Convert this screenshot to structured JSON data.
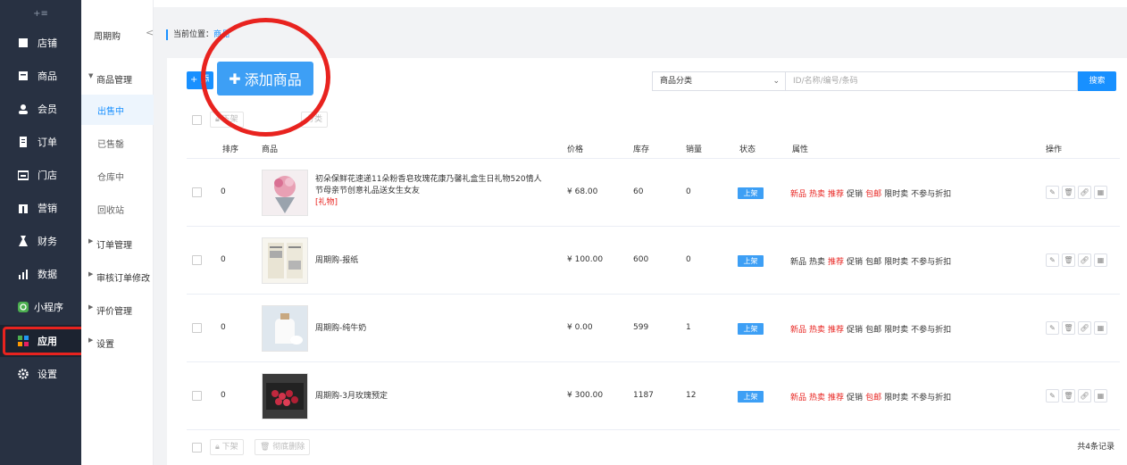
{
  "sidebar": {
    "collapse_icon": "+≡",
    "items": [
      {
        "label": "店铺",
        "icon": "shop-icon"
      },
      {
        "label": "商品",
        "icon": "goods-icon"
      },
      {
        "label": "会员",
        "icon": "member-icon"
      },
      {
        "label": "订单",
        "icon": "order-icon"
      },
      {
        "label": "门店",
        "icon": "store-icon"
      },
      {
        "label": "营销",
        "icon": "gift-icon"
      },
      {
        "label": "财务",
        "icon": "finance-icon"
      },
      {
        "label": "数据",
        "icon": "chart-icon"
      },
      {
        "label": "小程序",
        "icon": "miniprogram-icon"
      },
      {
        "label": "应用",
        "icon": "apps-icon"
      },
      {
        "label": "设置",
        "icon": "gear-icon"
      }
    ]
  },
  "submenu": {
    "title": "周期购",
    "collapse_arrow": "<",
    "groups": [
      {
        "label": "商品管理",
        "expanded": true
      },
      {
        "label": "订单管理"
      },
      {
        "label": "审核订单修改"
      },
      {
        "label": "评价管理"
      },
      {
        "label": "设置"
      }
    ],
    "items": [
      "出售中",
      "已售罄",
      "仓库中",
      "回收站"
    ]
  },
  "breadcrumb": {
    "prefix": "当前位置：",
    "link": "商品"
  },
  "toolbar": {
    "small_add": "+ 添",
    "big_add": "添加商品",
    "category_select": "商品分类",
    "search_placeholder": "ID/名称/编号/条码",
    "search_button": "搜索",
    "top_btn1": "下架",
    "top_btn2": "分类"
  },
  "table": {
    "headers": {
      "sort": "排序",
      "product": "商品",
      "price": "价格",
      "stock": "库存",
      "sales": "销量",
      "status": "状态",
      "attrs": "属性",
      "ops": "操作"
    },
    "rows": [
      {
        "sort": "0",
        "name": "初朵保鲜花速递11朵粉香皂玫瑰花康乃馨礼盒生日礼物520情人节母亲节创意礼品送女生女友",
        "tag": "[礼物]",
        "price": "¥ 68.00",
        "stock": "60",
        "sales": "0",
        "status": "上架",
        "attrs": [
          {
            "t": "新品",
            "c": "#e8231f"
          },
          {
            "t": "热卖",
            "c": "#e8231f"
          },
          {
            "t": "推荐",
            "c": "#e8231f"
          },
          {
            "t": "促销",
            "c": "#333"
          },
          {
            "t": "包邮",
            "c": "#e8231f"
          },
          {
            "t": "限时卖",
            "c": "#333"
          },
          {
            "t": "不参与折扣",
            "c": "#333"
          }
        ]
      },
      {
        "sort": "0",
        "name": "周期购-报纸",
        "tag": "",
        "price": "¥ 100.00",
        "stock": "600",
        "sales": "0",
        "status": "上架",
        "attrs": [
          {
            "t": "新品",
            "c": "#333"
          },
          {
            "t": "热卖",
            "c": "#333"
          },
          {
            "t": "推荐",
            "c": "#e8231f"
          },
          {
            "t": "促销",
            "c": "#333"
          },
          {
            "t": "包邮",
            "c": "#333"
          },
          {
            "t": "限时卖",
            "c": "#333"
          },
          {
            "t": "不参与折扣",
            "c": "#333"
          }
        ]
      },
      {
        "sort": "0",
        "name": "周期购-纯牛奶",
        "tag": "",
        "price": "¥ 0.00",
        "stock": "599",
        "sales": "1",
        "status": "上架",
        "attrs": [
          {
            "t": "新品",
            "c": "#e8231f"
          },
          {
            "t": "热卖",
            "c": "#e8231f"
          },
          {
            "t": "推荐",
            "c": "#e8231f"
          },
          {
            "t": "促销",
            "c": "#333"
          },
          {
            "t": "包邮",
            "c": "#333"
          },
          {
            "t": "限时卖",
            "c": "#333"
          },
          {
            "t": "不参与折扣",
            "c": "#333"
          }
        ]
      },
      {
        "sort": "0",
        "name": "周期购-3月玫瑰预定",
        "tag": "",
        "price": "¥ 300.00",
        "stock": "1187",
        "sales": "12",
        "status": "上架",
        "attrs": [
          {
            "t": "新品",
            "c": "#e8231f"
          },
          {
            "t": "热卖",
            "c": "#e8231f"
          },
          {
            "t": "推荐",
            "c": "#e8231f"
          },
          {
            "t": "促销",
            "c": "#333"
          },
          {
            "t": "包邮",
            "c": "#e8231f"
          },
          {
            "t": "限时卖",
            "c": "#333"
          },
          {
            "t": "不参与折扣",
            "c": "#333"
          }
        ]
      }
    ]
  },
  "footer": {
    "btn_unlist": "下架",
    "btn_delete": "彻底删除",
    "total": "共4条记录"
  },
  "colors": {
    "accent": "#1890ff",
    "highlight_red": "#e8231f",
    "sidebar_bg": "#283142"
  }
}
